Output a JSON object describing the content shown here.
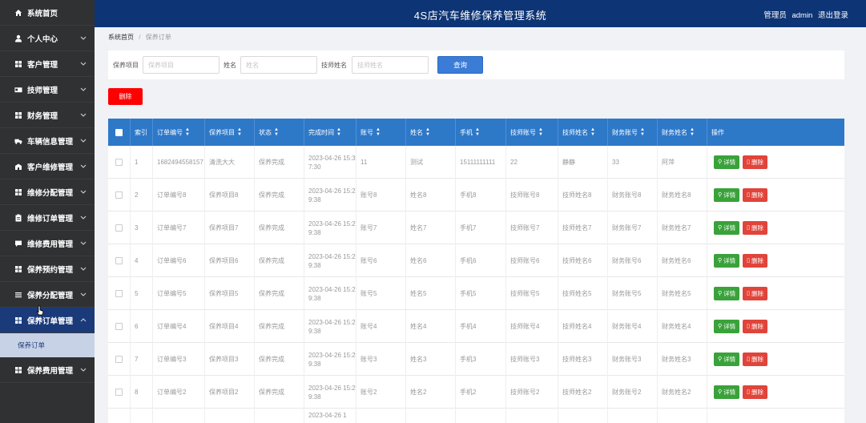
{
  "header": {
    "title": "4S店汽车维修保养管理系统",
    "role_label": "管理员",
    "username": "admin",
    "logout": "退出登录"
  },
  "sidebar": {
    "items": [
      {
        "label": "系统首页",
        "icon": "home-icon",
        "expandable": false
      },
      {
        "label": "个人中心",
        "icon": "user-icon",
        "expandable": true
      },
      {
        "label": "客户管理",
        "icon": "grid-icon",
        "expandable": true
      },
      {
        "label": "技师管理",
        "icon": "card-icon",
        "expandable": true
      },
      {
        "label": "财务管理",
        "icon": "grid-icon",
        "expandable": true
      },
      {
        "label": "车辆信息管理",
        "icon": "truck-icon",
        "expandable": true
      },
      {
        "label": "客户维修管理",
        "icon": "building-icon",
        "expandable": true
      },
      {
        "label": "维修分配管理",
        "icon": "grid-icon",
        "expandable": true
      },
      {
        "label": "维修订单管理",
        "icon": "clipboard-icon",
        "expandable": true
      },
      {
        "label": "维修费用管理",
        "icon": "comment-icon",
        "expandable": true
      },
      {
        "label": "保养预约管理",
        "icon": "grid-icon",
        "expandable": true
      },
      {
        "label": "保养分配管理",
        "icon": "list-icon",
        "expandable": true
      },
      {
        "label": "保养订单管理",
        "icon": "grid-icon",
        "expandable": true,
        "active": true
      },
      {
        "label": "保养费用管理",
        "icon": "grid-icon",
        "expandable": true
      }
    ],
    "sub_item": "保养订单"
  },
  "breadcrumb": {
    "home": "系统首页",
    "current": "保养订单"
  },
  "search": {
    "fields": [
      {
        "label": "保养项目",
        "placeholder": "保养项目"
      },
      {
        "label": "姓名",
        "placeholder": "姓名"
      },
      {
        "label": "技师姓名",
        "placeholder": "技师姓名"
      }
    ],
    "query_button": "查询"
  },
  "delete_button": "删除",
  "table": {
    "columns": [
      "索引",
      "订单编号",
      "保养项目",
      "状态",
      "完成时间",
      "账号",
      "姓名",
      "手机",
      "技师账号",
      "技师姓名",
      "财务账号",
      "财务姓名",
      "操作"
    ],
    "sortable": [
      false,
      true,
      true,
      true,
      true,
      true,
      true,
      true,
      true,
      true,
      true,
      true,
      false
    ],
    "detail_label": "详情",
    "delete_label": "删除",
    "rows": [
      [
        "1",
        "1682494558157",
        "清洗大大",
        "保养完成",
        "2023-04-26 15:37:30",
        "11",
        "测试",
        "15111111111",
        "22",
        "静静",
        "33",
        "阿萍"
      ],
      [
        "2",
        "订单编号8",
        "保养项目8",
        "保养完成",
        "2023-04-26 15:29:38",
        "账号8",
        "姓名8",
        "手机8",
        "技师账号8",
        "技师姓名8",
        "财务账号8",
        "财务姓名8"
      ],
      [
        "3",
        "订单编号7",
        "保养项目7",
        "保养完成",
        "2023-04-26 15:29:38",
        "账号7",
        "姓名7",
        "手机7",
        "技师账号7",
        "技师姓名7",
        "财务账号7",
        "财务姓名7"
      ],
      [
        "4",
        "订单编号6",
        "保养项目6",
        "保养完成",
        "2023-04-26 15:29:38",
        "账号6",
        "姓名6",
        "手机6",
        "技师账号6",
        "技师姓名6",
        "财务账号6",
        "财务姓名6"
      ],
      [
        "5",
        "订单编号5",
        "保养项目5",
        "保养完成",
        "2023-04-26 15:29:38",
        "账号5",
        "姓名5",
        "手机5",
        "技师账号5",
        "技师姓名5",
        "财务账号5",
        "财务姓名5"
      ],
      [
        "6",
        "订单编号4",
        "保养项目4",
        "保养完成",
        "2023-04-26 15:29:38",
        "账号4",
        "姓名4",
        "手机4",
        "技师账号4",
        "技师姓名4",
        "财务账号4",
        "财务姓名4"
      ],
      [
        "7",
        "订单编号3",
        "保养项目3",
        "保养完成",
        "2023-04-26 15:29:38",
        "账号3",
        "姓名3",
        "手机3",
        "技师账号3",
        "技师姓名3",
        "财务账号3",
        "财务姓名3"
      ],
      [
        "8",
        "订单编号2",
        "保养项目2",
        "保养完成",
        "2023-04-26 15:29:38",
        "账号2",
        "姓名2",
        "手机2",
        "技师账号2",
        "技师姓名2",
        "财务账号2",
        "财务姓名2"
      ],
      [
        "",
        "",
        "",
        "",
        "2023-04-26 1",
        "",
        "",
        "",
        "",
        "",
        "",
        ""
      ]
    ]
  },
  "colors": {
    "header_bg": "#0d3475",
    "sidebar_bg": "#2f3133",
    "table_head_bg": "#2e78c8",
    "query_button": "#3b7cd6",
    "delete_red": "#ff0000",
    "detail_green": "#3aa23a"
  }
}
